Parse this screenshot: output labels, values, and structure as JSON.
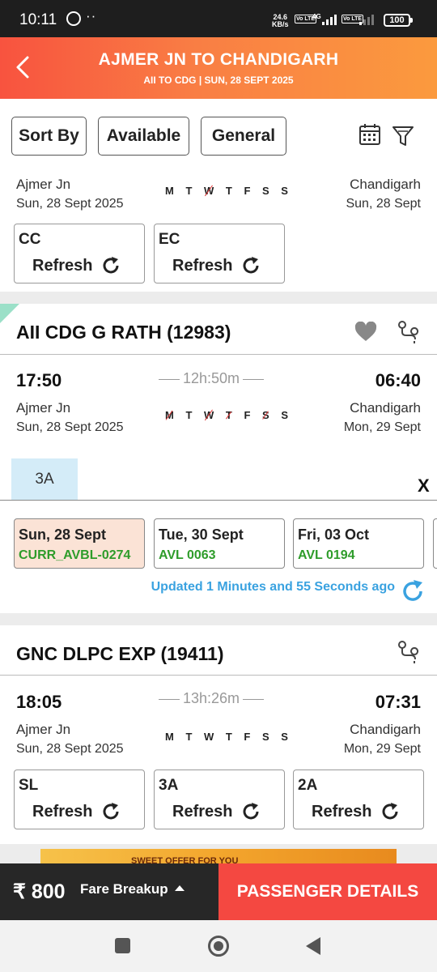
{
  "status_bar": {
    "time": "10:11",
    "speed_value": "24.6",
    "speed_unit": "KB/s",
    "network": "4G",
    "lte_label": "Vo LTE",
    "battery": "100"
  },
  "header": {
    "title": "AJMER JN TO CHANDIGARH",
    "subtitle": "AII TO CDG | SUN, 28 SEPT  2025"
  },
  "filters": {
    "sort_by": "Sort By",
    "available": "Available",
    "general": "General"
  },
  "days_label": "M T W T F S S",
  "trains": [
    {
      "from": "Ajmer Jn",
      "from_date": "Sun, 28 Sept  2025",
      "to": "Chandigarh",
      "to_date": "Sun, 28 Sept",
      "classes": [
        {
          "code": "CC",
          "action": "Refresh"
        },
        {
          "code": "EC",
          "action": "Refresh"
        }
      ]
    },
    {
      "name": "AII CDG G RATH",
      "number": "(12983)",
      "depart_time": "17:50",
      "duration": "12h:50m",
      "arrive_time": "06:40",
      "from": "Ajmer Jn",
      "from_date": "Sun, 28 Sept  2025",
      "to": "Chandigarh",
      "to_date": "Mon, 29 Sept",
      "selected_class": "3A",
      "close_label": "X",
      "availability": [
        {
          "date": "Sun, 28 Sept",
          "status": "CURR_AVBL-0274"
        },
        {
          "date": "Tue, 30 Sept",
          "status": "AVL 0063"
        },
        {
          "date": "Fri, 03 Oct",
          "status": "AVL 0194"
        }
      ],
      "updated_text": "Updated 1 Minutes and 55 Seconds ago"
    },
    {
      "name": "GNC DLPC EXP",
      "number": "(19411)",
      "depart_time": "18:05",
      "duration": "13h:26m",
      "arrive_time": "07:31",
      "from": "Ajmer Jn",
      "from_date": "Sun, 28 Sept  2025",
      "to": "Chandigarh",
      "to_date": "Mon, 29 Sept",
      "classes": [
        {
          "code": "SL",
          "action": "Refresh"
        },
        {
          "code": "3A",
          "action": "Refresh"
        },
        {
          "code": "2A",
          "action": "Refresh"
        }
      ]
    }
  ],
  "ad_text": "SWEET OFFER FOR YOU",
  "bottom": {
    "fare": "₹ 800",
    "fare_breakup": "Fare Breakup",
    "passenger_details": "PASSENGER DETAILS"
  },
  "colors": {
    "header_start": "#f8533f",
    "header_end": "#fb9a3e",
    "available_green": "#2e9c2a",
    "update_blue": "#3aa2e0",
    "cta_red": "#f44841",
    "selected_date_bg": "#fbe3d6",
    "selected_class_bg": "#d4ecf8"
  }
}
